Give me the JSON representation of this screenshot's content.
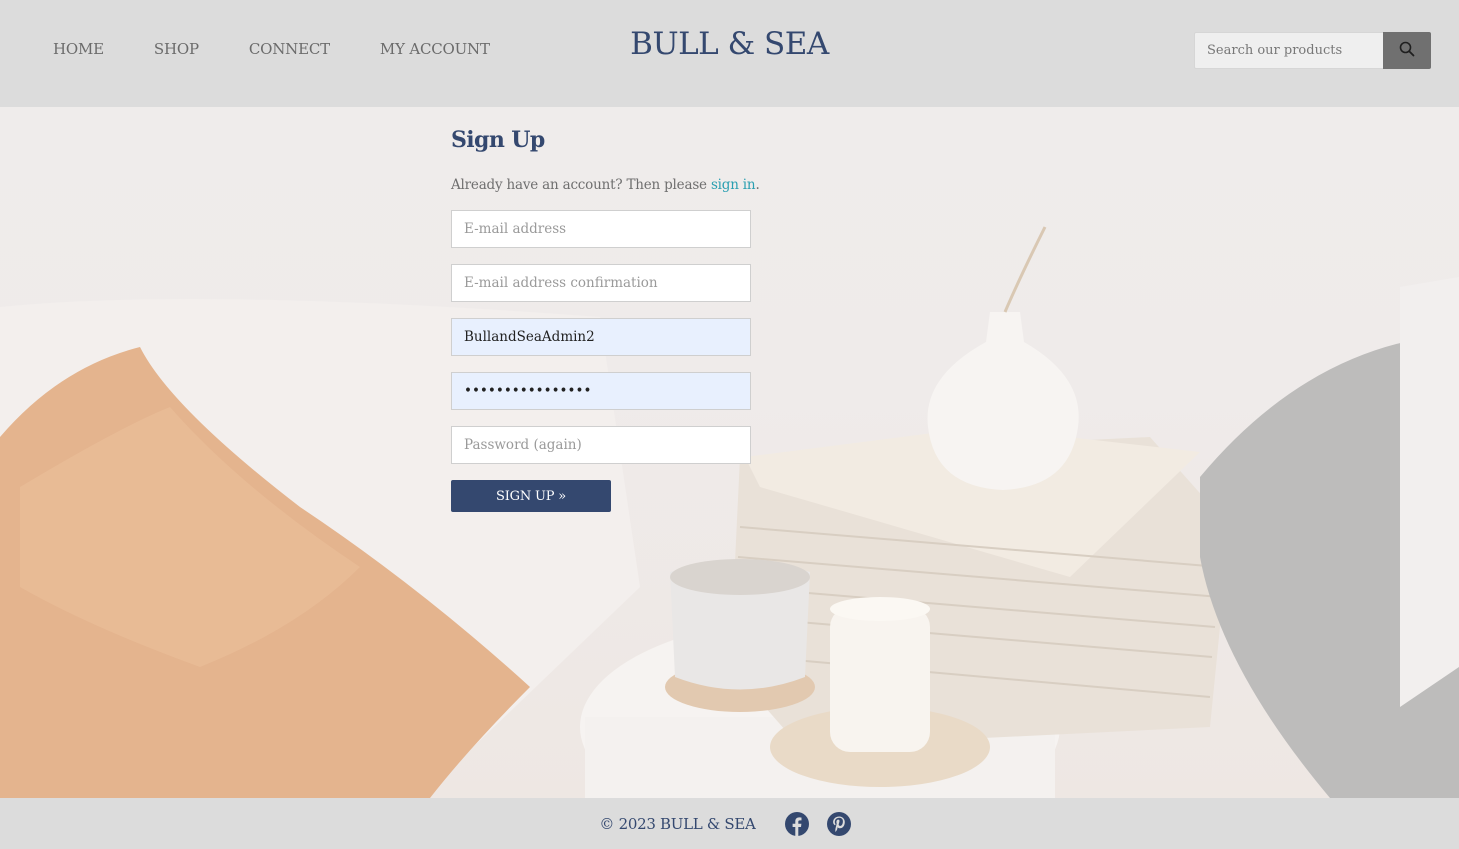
{
  "header": {
    "nav": [
      {
        "label": "HOME"
      },
      {
        "label": "SHOP"
      },
      {
        "label": "CONNECT"
      },
      {
        "label": "MY ACCOUNT"
      }
    ],
    "brand": "BULL & SEA",
    "search": {
      "placeholder": "Search our products",
      "button_icon": "search-icon"
    }
  },
  "form": {
    "title": "Sign Up",
    "intro_text": "Already have an account? Then please ",
    "intro_link": "sign in",
    "intro_suffix": ".",
    "fields": {
      "email": {
        "placeholder": "E-mail address",
        "value": ""
      },
      "email_confirm": {
        "placeholder": "E-mail address confirmation",
        "value": ""
      },
      "username": {
        "value": "BullandSeaAdmin2"
      },
      "password": {
        "value": "••••••••••••••••"
      },
      "password_again": {
        "placeholder": "Password (again)",
        "value": ""
      }
    },
    "submit_label": "SIGN UP »"
  },
  "footer": {
    "copyright": "© 2023 BULL & SEA",
    "social": [
      "facebook-icon",
      "pinterest-icon"
    ]
  },
  "colors": {
    "brand": "#34486f",
    "link": "#2a9fb1",
    "header_bg": "#dcdcdc",
    "autofill_bg": "#e8f0fe",
    "search_button": "#707070"
  }
}
